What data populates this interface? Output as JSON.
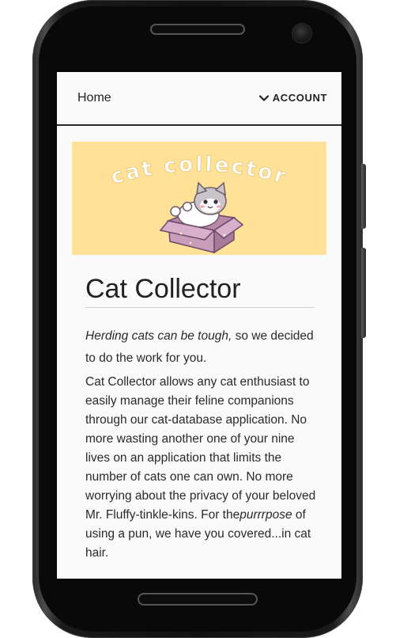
{
  "nav": {
    "home_label": "Home",
    "account_label": "ACCOUNT"
  },
  "banner": {
    "text": "cat collector",
    "icon": "cat-in-box"
  },
  "content": {
    "title": "Cat Collector",
    "intro_italic": "Herding cats can be tough,",
    "intro_rest": " so we decided to do the work for you.",
    "body_part1": "Cat Collector allows any cat enthusiast to easily manage their feline companions through our cat-database application. No more wasting another one of your nine lives on an application that limits the number of cats one can own. No more worrying about the privacy of your beloved Mr. Fluffy-tinkle-kins. For the",
    "body_italic": "purrrpose",
    "body_part2": " of using a pun, we have you covered...in cat hair."
  },
  "colors": {
    "banner_bg": "#ffe198",
    "screen_bg": "#fafafa",
    "text": "#222222",
    "frame": "#111111"
  }
}
